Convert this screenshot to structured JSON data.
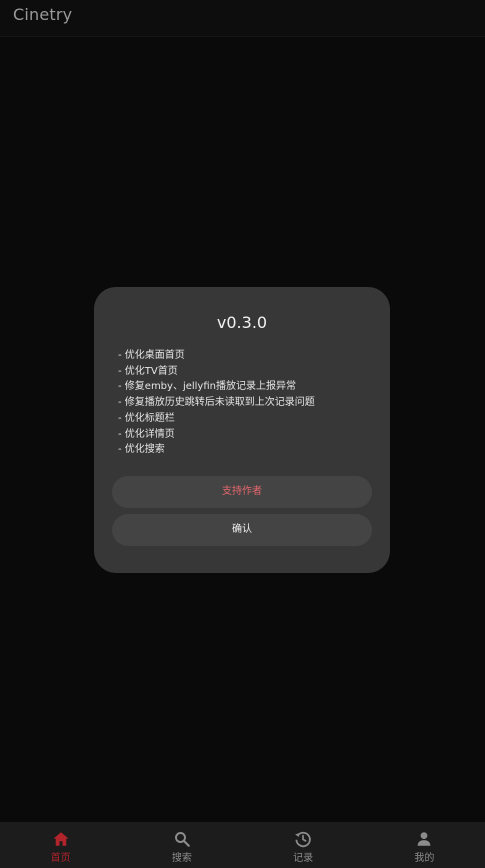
{
  "app": {
    "title": "Cinetry"
  },
  "dialog": {
    "version": "v0.3.0",
    "changelog": [
      "- 优化桌面首页",
      "- 优化TV首页",
      "- 修复emby、jellyfin播放记录上报异常",
      "- 修复播放历史跳转后未读取到上次记录问题",
      "- 优化标题栏",
      "- 优化详情页",
      "- 优化搜索"
    ],
    "support_label": "支持作者",
    "confirm_label": "确认"
  },
  "nav": {
    "items": [
      {
        "label": "首页",
        "icon": "home-icon",
        "active": true
      },
      {
        "label": "搜索",
        "icon": "search-icon",
        "active": false
      },
      {
        "label": "记录",
        "icon": "history-icon",
        "active": false
      },
      {
        "label": "我的",
        "icon": "person-icon",
        "active": false
      }
    ]
  },
  "colors": {
    "accent": "#b2242b",
    "support_text": "#e5676d",
    "dialog_bg": "#373737",
    "button_bg": "#444444",
    "background": "#0b0b0b"
  }
}
